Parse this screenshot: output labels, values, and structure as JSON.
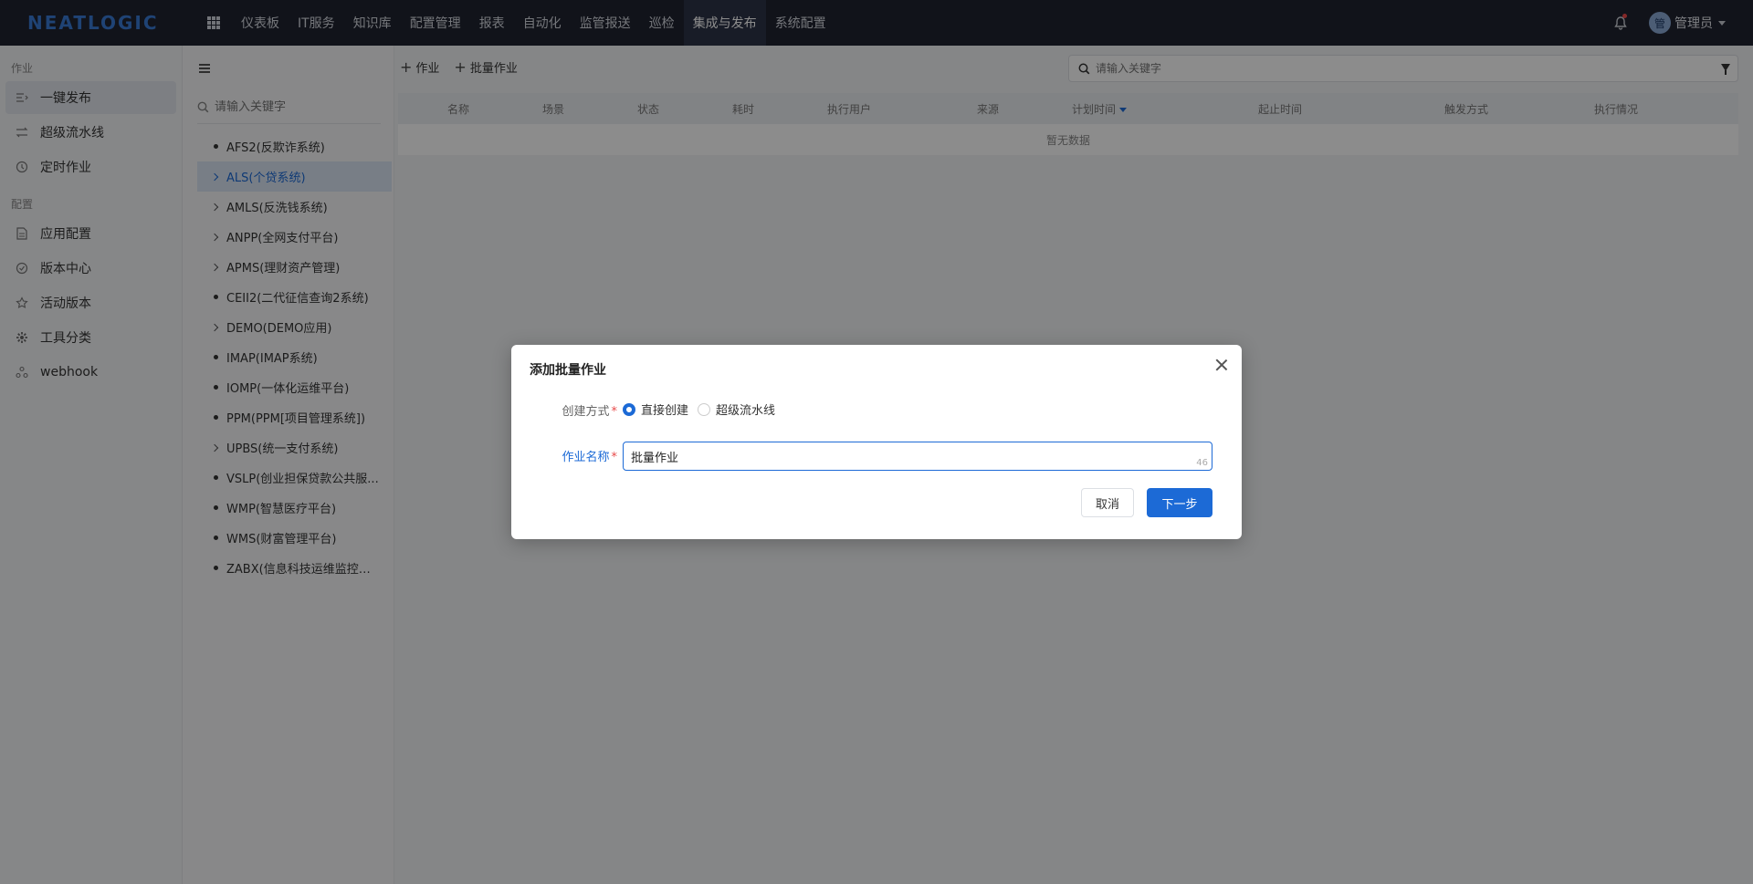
{
  "app": {
    "logo_text": "NEATLOGIC",
    "brand_color": "#3a7bd5",
    "accent_color": "#1c6ad6"
  },
  "topnav": {
    "items": [
      {
        "label": "仪表板",
        "active": false
      },
      {
        "label": "IT服务",
        "active": false
      },
      {
        "label": "知识库",
        "active": false
      },
      {
        "label": "配置管理",
        "active": false
      },
      {
        "label": "报表",
        "active": false
      },
      {
        "label": "自动化",
        "active": false
      },
      {
        "label": "监管报送",
        "active": false
      },
      {
        "label": "巡检",
        "active": false
      },
      {
        "label": "集成与发布",
        "active": true
      },
      {
        "label": "系统配置",
        "active": false
      }
    ],
    "user": {
      "name": "管理员",
      "avatar_text": "管"
    }
  },
  "sidebar": {
    "group_job": "作业",
    "job_items": [
      {
        "label": "一键发布",
        "icon": "publish-icon",
        "active": true
      },
      {
        "label": "超级流水线",
        "icon": "pipeline-icon",
        "active": false
      },
      {
        "label": "定时作业",
        "icon": "clock-icon",
        "active": false
      }
    ],
    "group_config": "配置",
    "config_items": [
      {
        "label": "应用配置",
        "icon": "file-icon"
      },
      {
        "label": "版本中心",
        "icon": "version-icon"
      },
      {
        "label": "活动版本",
        "icon": "star-icon"
      },
      {
        "label": "工具分类",
        "icon": "gear-icon"
      },
      {
        "label": "webhook",
        "icon": "webhook-icon"
      }
    ]
  },
  "tree": {
    "search_placeholder": "请输入关键字",
    "nodes": [
      {
        "label": "AFS2(反欺诈系统)",
        "expandable": false,
        "active": false
      },
      {
        "label": "ALS(个贷系统)",
        "expandable": true,
        "active": true
      },
      {
        "label": "AMLS(反洗钱系统)",
        "expandable": true,
        "active": false
      },
      {
        "label": "ANPP(全网支付平台)",
        "expandable": true,
        "active": false
      },
      {
        "label": "APMS(理财资产管理)",
        "expandable": true,
        "active": false
      },
      {
        "label": "CEII2(二代征信查询2系统)",
        "expandable": false,
        "active": false
      },
      {
        "label": "DEMO(DEMO应用)",
        "expandable": true,
        "active": false
      },
      {
        "label": "IMAP(IMAP系统)",
        "expandable": false,
        "active": false
      },
      {
        "label": "IOMP(一体化运维平台)",
        "expandable": false,
        "active": false
      },
      {
        "label": "PPM(PPM[项目管理系统])",
        "expandable": false,
        "active": false
      },
      {
        "label": "UPBS(统一支付系统)",
        "expandable": true,
        "active": false
      },
      {
        "label": "VSLP(创业担保贷款公共服...",
        "expandable": false,
        "active": false
      },
      {
        "label": "WMP(智慧医疗平台)",
        "expandable": false,
        "active": false
      },
      {
        "label": "WMS(财富管理平台)",
        "expandable": false,
        "active": false
      },
      {
        "label": "ZABX(信息科技运维监控系...",
        "expandable": false,
        "active": false
      }
    ]
  },
  "main": {
    "add_job_label": "作业",
    "add_batch_label": "批量作业",
    "search_placeholder": "请输入关键字",
    "table": {
      "columns": [
        "名称",
        "场景",
        "状态",
        "耗时",
        "执行用户",
        "来源",
        "计划时间",
        "起止时间",
        "触发方式",
        "执行情况"
      ],
      "sorted_column": "计划时间",
      "empty_text": "暂无数据"
    }
  },
  "modal": {
    "title": "添加批量作业",
    "create_mode_label": "创建方式",
    "options": [
      {
        "label": "直接创建",
        "checked": true
      },
      {
        "label": "超级流水线",
        "checked": false
      }
    ],
    "name_label": "作业名称",
    "name_value": "批量作业",
    "name_counter": "46",
    "cancel_label": "取消",
    "next_label": "下一步"
  }
}
